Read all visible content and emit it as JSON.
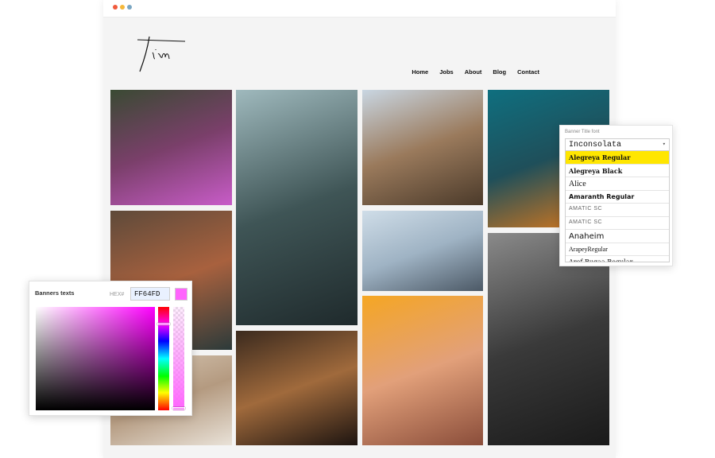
{
  "window_dots": [
    {
      "name": "close",
      "color": "#f05a3c"
    },
    {
      "name": "minimize",
      "color": "#f5b83a"
    },
    {
      "name": "maximize",
      "color": "#7aa6c2"
    }
  ],
  "site": {
    "logo_text": "tim",
    "nav": [
      "Home",
      "Jobs",
      "About",
      "Blog",
      "Contact"
    ]
  },
  "photos": [
    {
      "name": "woman-flowers",
      "colors": [
        "#3a4a33",
        "#7a3f6a",
        "#c85cc8"
      ]
    },
    {
      "name": "woman-feathers",
      "colors": [
        "#5e4a3a",
        "#a8613e",
        "#2c3a3a"
      ]
    },
    {
      "name": "woman-knit",
      "colors": [
        "#d8c9b6",
        "#b49a80",
        "#e9e2d8"
      ]
    },
    {
      "name": "forest-road",
      "colors": [
        "#9fb9bd",
        "#3f5556",
        "#1f2a2c"
      ]
    },
    {
      "name": "man-frame",
      "colors": [
        "#3b2a1e",
        "#a06a3c",
        "#1d1410"
      ]
    },
    {
      "name": "man-glasses",
      "colors": [
        "#c9d6e2",
        "#9a7a5c",
        "#4b3a2a"
      ]
    },
    {
      "name": "boy-violin",
      "colors": [
        "#cfdde8",
        "#9fb3c4",
        "#4c5966"
      ]
    },
    {
      "name": "woman-oranges",
      "colors": [
        "#f5a623",
        "#e2a07a",
        "#8a4d3a"
      ]
    },
    {
      "name": "woman-teal",
      "colors": [
        "#0f6f7f",
        "#1f4f5a",
        "#e07a1a"
      ]
    },
    {
      "name": "hoodie-mural",
      "colors": [
        "#8a8a8a",
        "#3a3a3a",
        "#1a1a1a"
      ]
    }
  ],
  "color_picker": {
    "title": "Banners texts",
    "hex_label": "HEX#",
    "hex_value": "FF64FD",
    "swatch_color": "#ff64fd"
  },
  "font_panel": {
    "label": "Banner Title font",
    "selected": "Inconsolata",
    "options": [
      "Alegreya Regular",
      "Alegreya Black",
      "Alice",
      "Amaranth Regular",
      "AMATIC SC",
      "AMATIC SC",
      "Anaheim",
      "ArapeyRegular",
      "Aref Ruqaa Regular"
    ],
    "highlighted_index": 0,
    "highlight_color": "#ffe600"
  }
}
